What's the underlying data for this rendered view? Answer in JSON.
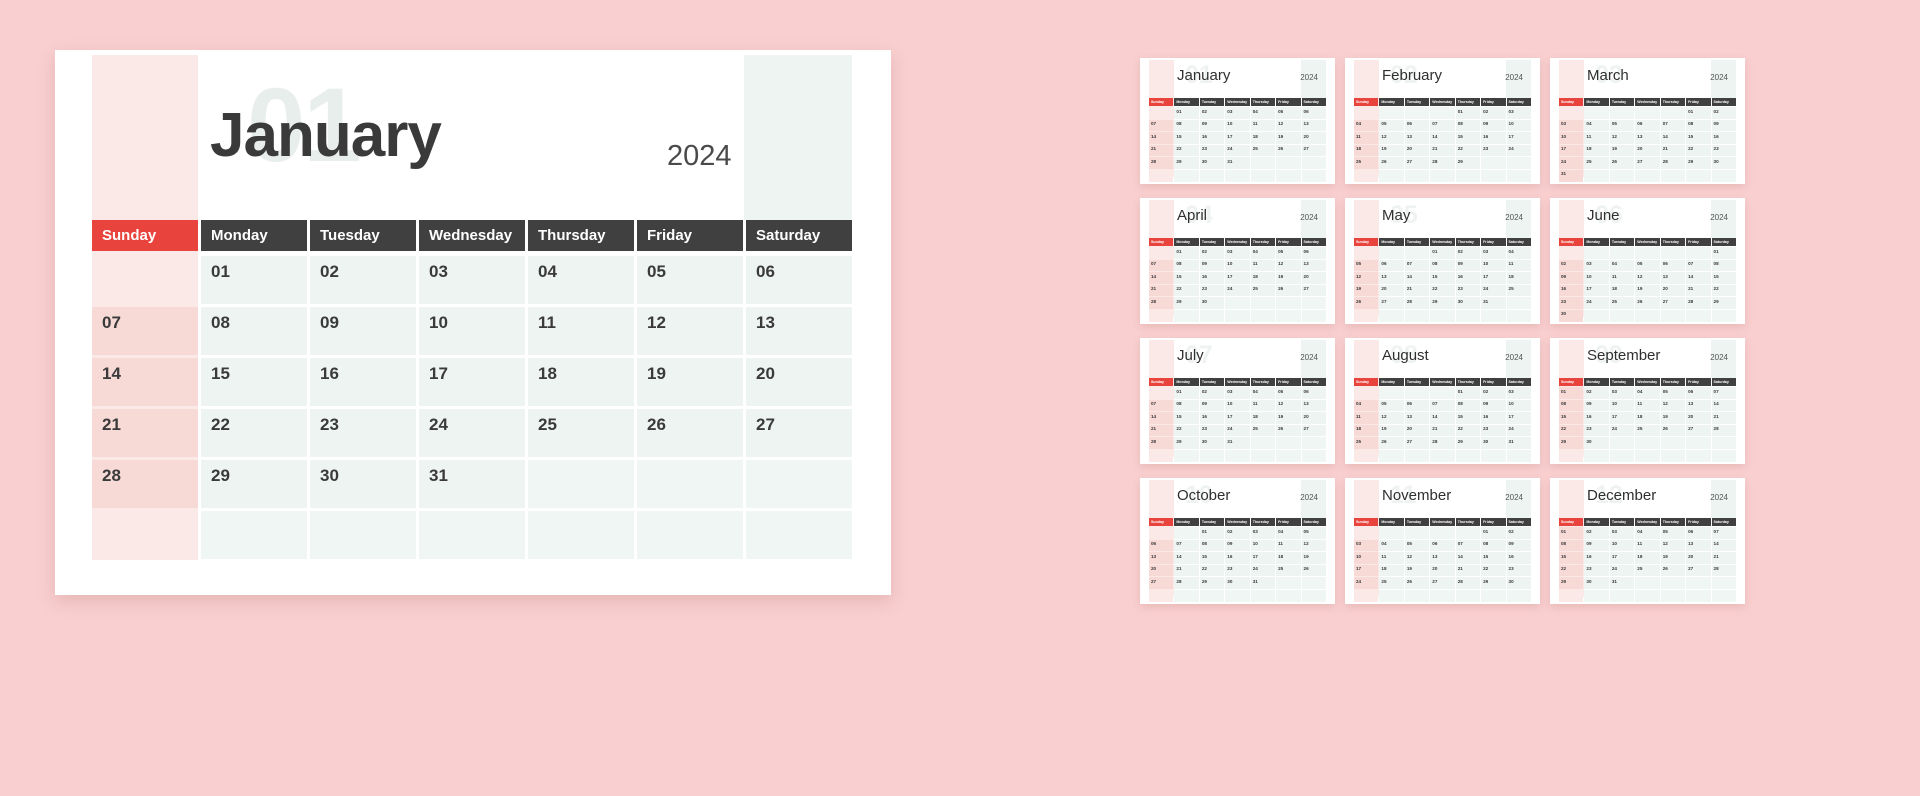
{
  "theme": {
    "background": "#f9cfcf",
    "card_background": "#ffffff",
    "sunday_accent": "#e8433c",
    "weekday_header": "#404040",
    "weekday_cell": "#edf4f1",
    "sunday_cell": "#f7d9d6",
    "text_dark": "#3a3a3a"
  },
  "main_calendar": {
    "watermark": "01",
    "month": "January",
    "year": "2024",
    "day_headers": [
      "Sunday",
      "Monday",
      "Tuesday",
      "Wednesday",
      "Thursday",
      "Friday",
      "Saturday"
    ],
    "weeks": [
      [
        "",
        "01",
        "02",
        "03",
        "04",
        "05",
        "06"
      ],
      [
        "07",
        "08",
        "09",
        "10",
        "11",
        "12",
        "13"
      ],
      [
        "14",
        "15",
        "16",
        "17",
        "18",
        "19",
        "20"
      ],
      [
        "21",
        "22",
        "23",
        "24",
        "25",
        "26",
        "27"
      ],
      [
        "28",
        "29",
        "30",
        "31",
        "",
        "",
        ""
      ],
      [
        "",
        "",
        "",
        "",
        "",
        "",
        ""
      ]
    ]
  },
  "mini_day_headers": [
    "Sunday",
    "Monday",
    "Tuesday",
    "Wednesday",
    "Thursday",
    "Friday",
    "Saturday"
  ],
  "mini_calendars": [
    {
      "watermark": "01",
      "month": "January",
      "year": "2024",
      "weeks": [
        [
          "",
          "01",
          "02",
          "03",
          "04",
          "05",
          "06"
        ],
        [
          "07",
          "08",
          "09",
          "10",
          "11",
          "12",
          "13"
        ],
        [
          "14",
          "15",
          "16",
          "17",
          "18",
          "19",
          "20"
        ],
        [
          "21",
          "22",
          "23",
          "24",
          "25",
          "26",
          "27"
        ],
        [
          "28",
          "29",
          "30",
          "31",
          "",
          "",
          ""
        ],
        [
          "",
          "",
          "",
          "",
          "",
          "",
          ""
        ]
      ]
    },
    {
      "watermark": "02",
      "month": "February",
      "year": "2024",
      "weeks": [
        [
          "",
          "",
          "",
          "",
          "01",
          "02",
          "03"
        ],
        [
          "04",
          "05",
          "06",
          "07",
          "08",
          "09",
          "10"
        ],
        [
          "11",
          "12",
          "13",
          "14",
          "15",
          "16",
          "17"
        ],
        [
          "18",
          "19",
          "20",
          "21",
          "22",
          "23",
          "24"
        ],
        [
          "25",
          "26",
          "27",
          "28",
          "29",
          "",
          ""
        ],
        [
          "",
          "",
          "",
          "",
          "",
          "",
          ""
        ]
      ]
    },
    {
      "watermark": "03",
      "month": "March",
      "year": "2024",
      "weeks": [
        [
          "",
          "",
          "",
          "",
          "",
          "01",
          "02"
        ],
        [
          "03",
          "04",
          "05",
          "06",
          "07",
          "08",
          "09"
        ],
        [
          "10",
          "11",
          "12",
          "13",
          "14",
          "15",
          "16"
        ],
        [
          "17",
          "18",
          "19",
          "20",
          "21",
          "22",
          "23"
        ],
        [
          "24",
          "25",
          "26",
          "27",
          "28",
          "29",
          "30"
        ],
        [
          "31",
          "",
          "",
          "",
          "",
          "",
          ""
        ]
      ]
    },
    {
      "watermark": "04",
      "month": "April",
      "year": "2024",
      "weeks": [
        [
          "",
          "01",
          "02",
          "03",
          "04",
          "05",
          "06"
        ],
        [
          "07",
          "08",
          "09",
          "10",
          "11",
          "12",
          "13"
        ],
        [
          "14",
          "15",
          "16",
          "17",
          "18",
          "19",
          "20"
        ],
        [
          "21",
          "22",
          "23",
          "24",
          "25",
          "26",
          "27"
        ],
        [
          "28",
          "29",
          "30",
          "",
          "",
          "",
          ""
        ],
        [
          "",
          "",
          "",
          "",
          "",
          "",
          ""
        ]
      ]
    },
    {
      "watermark": "05",
      "month": "May",
      "year": "2024",
      "weeks": [
        [
          "",
          "",
          "",
          "01",
          "02",
          "03",
          "04"
        ],
        [
          "05",
          "06",
          "07",
          "08",
          "09",
          "10",
          "11"
        ],
        [
          "12",
          "13",
          "14",
          "15",
          "16",
          "17",
          "18"
        ],
        [
          "19",
          "20",
          "21",
          "22",
          "23",
          "24",
          "25"
        ],
        [
          "26",
          "27",
          "28",
          "29",
          "30",
          "31",
          ""
        ],
        [
          "",
          "",
          "",
          "",
          "",
          "",
          ""
        ]
      ]
    },
    {
      "watermark": "06",
      "month": "June",
      "year": "2024",
      "weeks": [
        [
          "",
          "",
          "",
          "",
          "",
          "",
          "01"
        ],
        [
          "02",
          "03",
          "04",
          "05",
          "06",
          "07",
          "08"
        ],
        [
          "09",
          "10",
          "11",
          "12",
          "13",
          "14",
          "15"
        ],
        [
          "16",
          "17",
          "18",
          "19",
          "20",
          "21",
          "22"
        ],
        [
          "23",
          "24",
          "25",
          "26",
          "27",
          "28",
          "29"
        ],
        [
          "30",
          "",
          "",
          "",
          "",
          "",
          ""
        ]
      ]
    },
    {
      "watermark": "07",
      "month": "July",
      "year": "2024",
      "weeks": [
        [
          "",
          "01",
          "02",
          "03",
          "04",
          "05",
          "06"
        ],
        [
          "07",
          "08",
          "09",
          "10",
          "11",
          "12",
          "13"
        ],
        [
          "14",
          "15",
          "16",
          "17",
          "18",
          "19",
          "20"
        ],
        [
          "21",
          "22",
          "23",
          "24",
          "25",
          "26",
          "27"
        ],
        [
          "28",
          "29",
          "30",
          "31",
          "",
          "",
          ""
        ],
        [
          "",
          "",
          "",
          "",
          "",
          "",
          ""
        ]
      ]
    },
    {
      "watermark": "08",
      "month": "August",
      "year": "2024",
      "weeks": [
        [
          "",
          "",
          "",
          "",
          "01",
          "02",
          "03"
        ],
        [
          "04",
          "05",
          "06",
          "07",
          "08",
          "09",
          "10"
        ],
        [
          "11",
          "12",
          "13",
          "14",
          "15",
          "16",
          "17"
        ],
        [
          "18",
          "19",
          "20",
          "21",
          "22",
          "23",
          "24"
        ],
        [
          "25",
          "26",
          "27",
          "28",
          "29",
          "30",
          "31"
        ],
        [
          "",
          "",
          "",
          "",
          "",
          "",
          ""
        ]
      ]
    },
    {
      "watermark": "09",
      "month": "September",
      "year": "2024",
      "weeks": [
        [
          "01",
          "02",
          "03",
          "04",
          "05",
          "06",
          "07"
        ],
        [
          "08",
          "09",
          "10",
          "11",
          "12",
          "13",
          "14"
        ],
        [
          "15",
          "16",
          "17",
          "18",
          "19",
          "20",
          "21"
        ],
        [
          "22",
          "23",
          "24",
          "25",
          "26",
          "27",
          "28"
        ],
        [
          "29",
          "30",
          "",
          "",
          "",
          "",
          ""
        ],
        [
          "",
          "",
          "",
          "",
          "",
          "",
          ""
        ]
      ]
    },
    {
      "watermark": "10",
      "month": "October",
      "year": "2024",
      "weeks": [
        [
          "",
          "",
          "01",
          "02",
          "03",
          "04",
          "05"
        ],
        [
          "06",
          "07",
          "08",
          "09",
          "10",
          "11",
          "12"
        ],
        [
          "13",
          "14",
          "15",
          "16",
          "17",
          "18",
          "19"
        ],
        [
          "20",
          "21",
          "22",
          "23",
          "24",
          "25",
          "26"
        ],
        [
          "27",
          "28",
          "29",
          "30",
          "31",
          "",
          ""
        ],
        [
          "",
          "",
          "",
          "",
          "",
          "",
          ""
        ]
      ]
    },
    {
      "watermark": "11",
      "month": "November",
      "year": "2024",
      "weeks": [
        [
          "",
          "",
          "",
          "",
          "",
          "01",
          "02"
        ],
        [
          "03",
          "04",
          "05",
          "06",
          "07",
          "08",
          "09"
        ],
        [
          "10",
          "11",
          "12",
          "13",
          "14",
          "15",
          "16"
        ],
        [
          "17",
          "18",
          "19",
          "20",
          "21",
          "22",
          "23"
        ],
        [
          "24",
          "25",
          "26",
          "27",
          "28",
          "29",
          "30"
        ],
        [
          "",
          "",
          "",
          "",
          "",
          "",
          ""
        ]
      ]
    },
    {
      "watermark": "12",
      "month": "December",
      "year": "2024",
      "weeks": [
        [
          "01",
          "02",
          "03",
          "04",
          "05",
          "06",
          "07"
        ],
        [
          "08",
          "09",
          "10",
          "11",
          "12",
          "13",
          "14"
        ],
        [
          "15",
          "16",
          "17",
          "18",
          "19",
          "20",
          "21"
        ],
        [
          "22",
          "23",
          "24",
          "25",
          "26",
          "27",
          "28"
        ],
        [
          "29",
          "30",
          "31",
          "",
          "",
          "",
          ""
        ],
        [
          "",
          "",
          "",
          "",
          "",
          "",
          ""
        ]
      ]
    }
  ]
}
